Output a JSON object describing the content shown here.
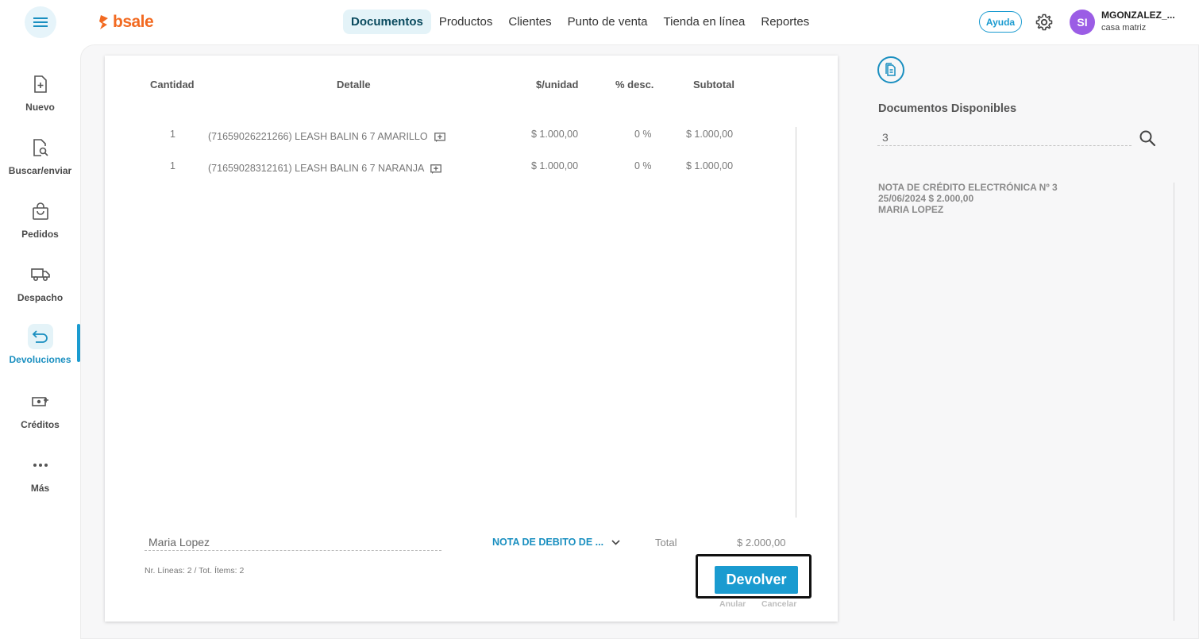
{
  "header": {
    "logo_text": "bsale",
    "nav": [
      "Documentos",
      "Productos",
      "Clientes",
      "Punto de venta",
      "Tienda en línea",
      "Reportes"
    ],
    "help_label": "Ayuda",
    "user": {
      "initials": "SI",
      "name": "MGONZALEZ_...",
      "branch": "casa matriz"
    }
  },
  "sidebar": {
    "items": [
      {
        "label": "Nuevo",
        "icon": "file-plus-icon"
      },
      {
        "label": "Buscar/enviar",
        "icon": "file-search-icon"
      },
      {
        "label": "Pedidos",
        "icon": "shopping-bag-icon"
      },
      {
        "label": "Despacho",
        "icon": "truck-icon"
      },
      {
        "label": "Devoluciones",
        "icon": "return-arrow-icon"
      },
      {
        "label": "Créditos",
        "icon": "money-plus-icon"
      },
      {
        "label": "Más",
        "icon": "more-dots-icon"
      }
    ],
    "active_index": 4
  },
  "table": {
    "headers": {
      "quantity": "Cantidad",
      "detail": "Detalle",
      "unit_price": "$/unidad",
      "discount": "% desc.",
      "subtotal": "Subtotal"
    },
    "rows": [
      {
        "quantity": "1",
        "detail": "(71659026221266) LEASH BALIN 6 7 AMARILLO",
        "unit_price": "$ 1.000,00",
        "discount": "0 %",
        "subtotal": "$ 1.000,00"
      },
      {
        "quantity": "1",
        "detail": "(71659028312161) LEASH BALIN 6 7 NARANJA",
        "unit_price": "$ 1.000,00",
        "discount": "0 %",
        "subtotal": "$ 1.000,00"
      }
    ]
  },
  "footer": {
    "client": "Maria Lopez",
    "doc_type": "NOTA DE DEBITO DE ...",
    "total_label": "Total",
    "total_value": "$ 2.000,00",
    "lines_info": "Nr. Líneas: 2 / Tot. Ítems: 2",
    "return_button": "Devolver",
    "void_link": "Anular",
    "cancel_link": "Cancelar"
  },
  "right_panel": {
    "title": "Documentos Disponibles",
    "search_value": "3",
    "documents": [
      {
        "title": "NOTA DE CRÉDITO ELECTRÓNICA Nº 3",
        "date_amount": "25/06/2024 $ 2.000,00",
        "client": "MARIA LOPEZ"
      }
    ]
  },
  "colors": {
    "accent": "#1a9bd0",
    "brand": "#f26a21",
    "avatar": "#9b5de5"
  }
}
